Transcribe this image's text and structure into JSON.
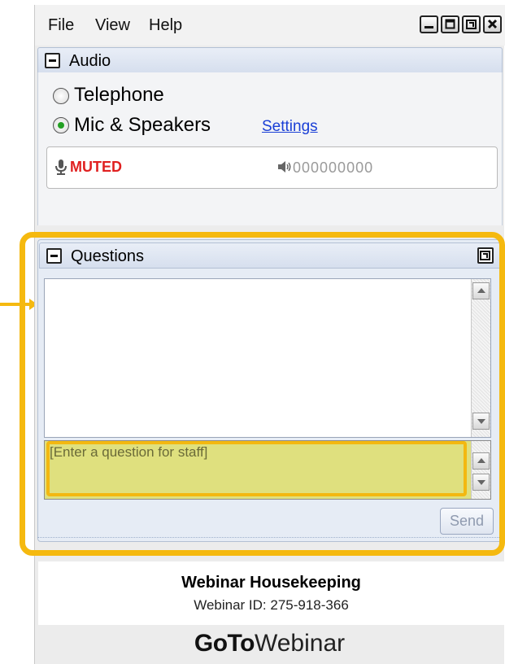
{
  "menu": {
    "file": "File",
    "view": "View",
    "help": "Help"
  },
  "window_controls": [
    "minimize-icon",
    "maximize-icon",
    "restore-icon",
    "close-icon"
  ],
  "audio": {
    "title": "Audio",
    "options": [
      {
        "label": "Telephone",
        "selected": false
      },
      {
        "label": "Mic & Speakers",
        "selected": true
      }
    ],
    "settings_link": "Settings",
    "muted_label": "MUTED",
    "level_digits": "000000000"
  },
  "questions": {
    "title": "Questions",
    "input_placeholder": "[Enter a question for staff]",
    "input_value": "",
    "send_label": "Send"
  },
  "footer": {
    "title": "Webinar Housekeeping",
    "webinar_id": "Webinar ID: 275-918-366",
    "brand_bold": "GoTo",
    "brand_regular": "Webinar"
  },
  "colors": {
    "highlight": "#f5b90f",
    "muted": "#e02020",
    "link": "#1a3fd6",
    "input_bg": "#dfe07e"
  }
}
